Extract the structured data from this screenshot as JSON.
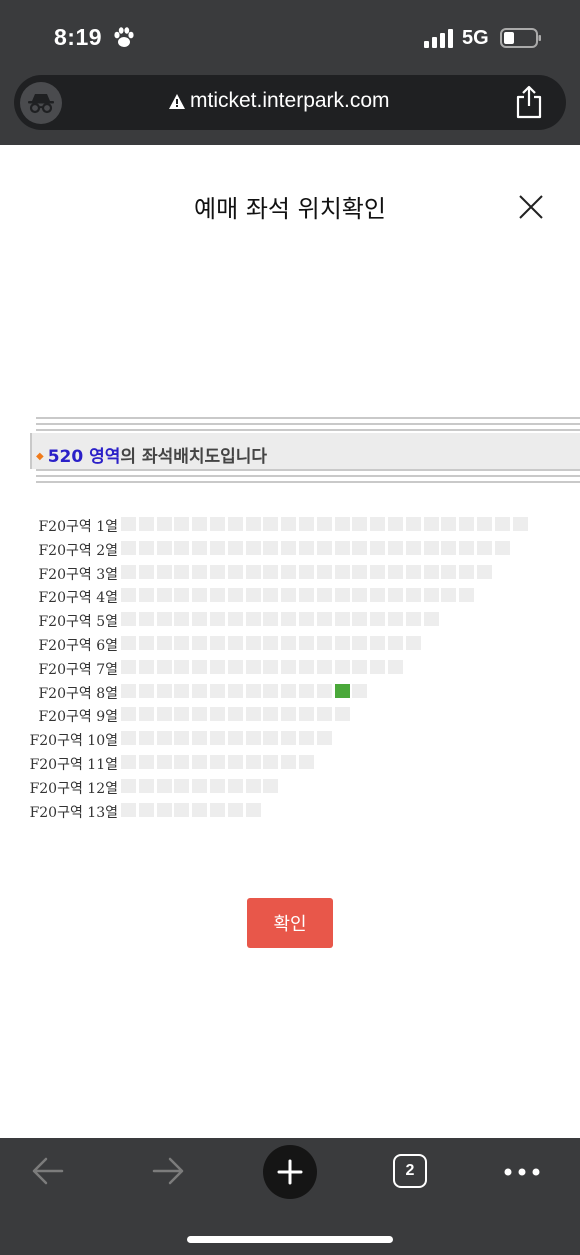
{
  "status_bar": {
    "time": "8:19",
    "network": "5G",
    "icons": [
      "paw-icon",
      "signal-icon",
      "battery-icon"
    ]
  },
  "browser": {
    "url": "mticket.interpark.com",
    "icons": [
      "incognito-icon",
      "warning-icon",
      "share-icon"
    ]
  },
  "modal": {
    "title": "예매 좌석 위치확인",
    "close_icon": "close-icon"
  },
  "banner": {
    "zone": "520 영역",
    "suffix": "의 좌석배치도입니다"
  },
  "seat_map": {
    "rows": [
      {
        "label": "F20구역 1열",
        "seats": 23,
        "selected": -1
      },
      {
        "label": "F20구역 2열",
        "seats": 22,
        "selected": -1
      },
      {
        "label": "F20구역 3열",
        "seats": 21,
        "selected": -1
      },
      {
        "label": "F20구역 4열",
        "seats": 20,
        "selected": -1
      },
      {
        "label": "F20구역 5열",
        "seats": 18,
        "selected": -1
      },
      {
        "label": "F20구역 6열",
        "seats": 17,
        "selected": -1
      },
      {
        "label": "F20구역 7열",
        "seats": 16,
        "selected": -1
      },
      {
        "label": "F20구역 8열",
        "seats": 14,
        "selected": 12
      },
      {
        "label": "F20구역 9열",
        "seats": 13,
        "selected": -1
      },
      {
        "label": "F20구역 10열",
        "seats": 12,
        "selected": -1
      },
      {
        "label": "F20구역 11열",
        "seats": 11,
        "selected": -1
      },
      {
        "label": "F20구역 12열",
        "seats": 9,
        "selected": -1
      },
      {
        "label": "F20구역 13열",
        "seats": 8,
        "selected": -1
      }
    ],
    "colors": {
      "empty": "#ededed",
      "selected": "#4aa83a"
    }
  },
  "confirm_button": {
    "label": "확인",
    "color": "#e8574a"
  },
  "toolbar": {
    "tab_count": "2",
    "icons": [
      "back-arrow-icon",
      "forward-arrow-icon",
      "plus-icon",
      "tabs-icon",
      "more-icon"
    ]
  }
}
